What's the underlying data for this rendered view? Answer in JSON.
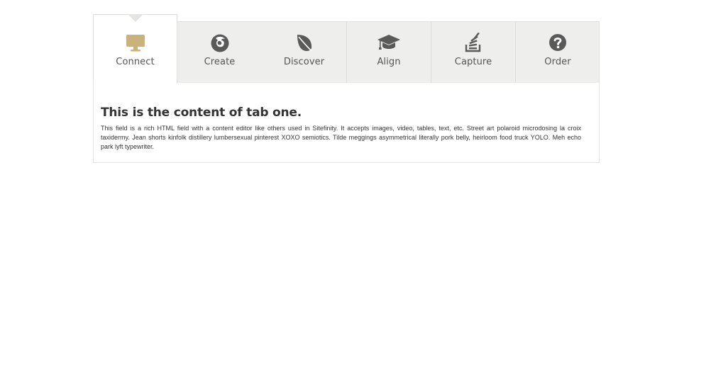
{
  "tabs": [
    {
      "label": "Connect",
      "icon": "monitor-icon",
      "active": true
    },
    {
      "label": "Create",
      "icon": "firefox-icon",
      "active": false
    },
    {
      "label": "Discover",
      "icon": "leaf-icon",
      "active": false
    },
    {
      "label": "Align",
      "icon": "graduation-cap-icon",
      "active": false
    },
    {
      "label": "Capture",
      "icon": "stack-overflow-icon",
      "active": false
    },
    {
      "label": "Order",
      "icon": "question-circle-icon",
      "active": false
    }
  ],
  "colors": {
    "active_icon": "#c9b27c",
    "inactive_icon": "#5a5a5a",
    "tab_background": "#eeeeec",
    "label_text": "#555555"
  },
  "panel": {
    "title": "This is the content of tab one.",
    "body": "This field is a rich HTML field with a content editor like others used in Sitefinity. It accepts images, video, tables, text, etc. Street art polaroid microdosing la croix taxidermy. Jean shorts kinfolk distillery lumbersexual pinterest XOXO semiotics. Tilde meggings asymmetrical literally pork belly, heirloom food truck YOLO. Meh echo park lyft typewriter."
  }
}
